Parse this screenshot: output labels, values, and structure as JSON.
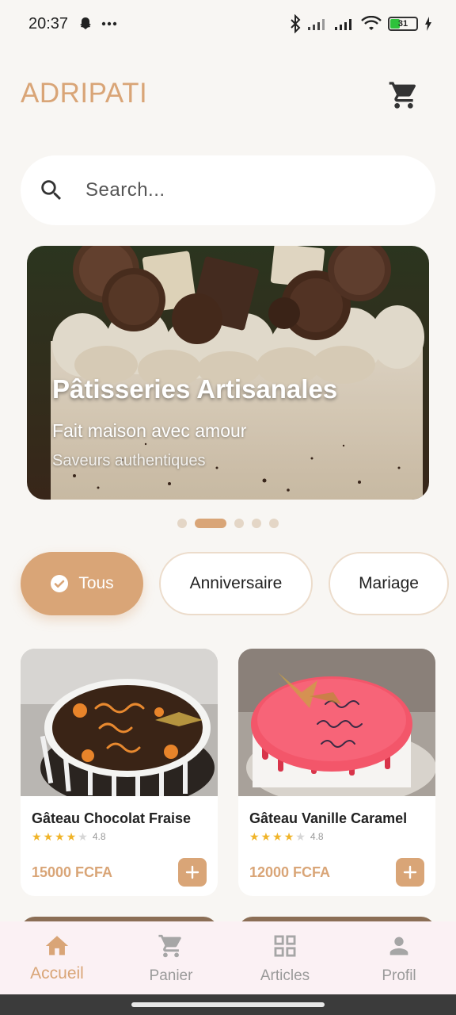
{
  "status_bar": {
    "time": "20:37",
    "battery": "31"
  },
  "header": {
    "title": "ADRIPATI"
  },
  "search": {
    "placeholder": "Search..."
  },
  "banner": {
    "title": "Pâtisseries Artisanales",
    "subtitle": "Fait maison avec amour",
    "tagline": "Saveurs authentiques",
    "dot_count": 5,
    "active_dot": 2
  },
  "categories": [
    {
      "label": "Tous",
      "active": true
    },
    {
      "label": "Anniversaire",
      "active": false
    },
    {
      "label": "Mariage",
      "active": false
    }
  ],
  "products": [
    {
      "name": "Gâteau Chocolat Fraise",
      "rating": "4.8",
      "stars": 4,
      "price": "15000 FCFA"
    },
    {
      "name": "Gâteau Vanille Caramel",
      "rating": "4.8",
      "stars": 4,
      "price": "12000 FCFA"
    }
  ],
  "bottom_nav": [
    {
      "label": "Accueil",
      "icon": "home-icon",
      "active": true
    },
    {
      "label": "Panier",
      "icon": "cart-icon",
      "active": false
    },
    {
      "label": "Articles",
      "icon": "grid-icon",
      "active": false
    },
    {
      "label": "Profil",
      "icon": "person-icon",
      "active": false
    }
  ],
  "colors": {
    "accent": "#d9a577",
    "background": "#f8f6f3",
    "nav_background": "#fbf1f4"
  }
}
